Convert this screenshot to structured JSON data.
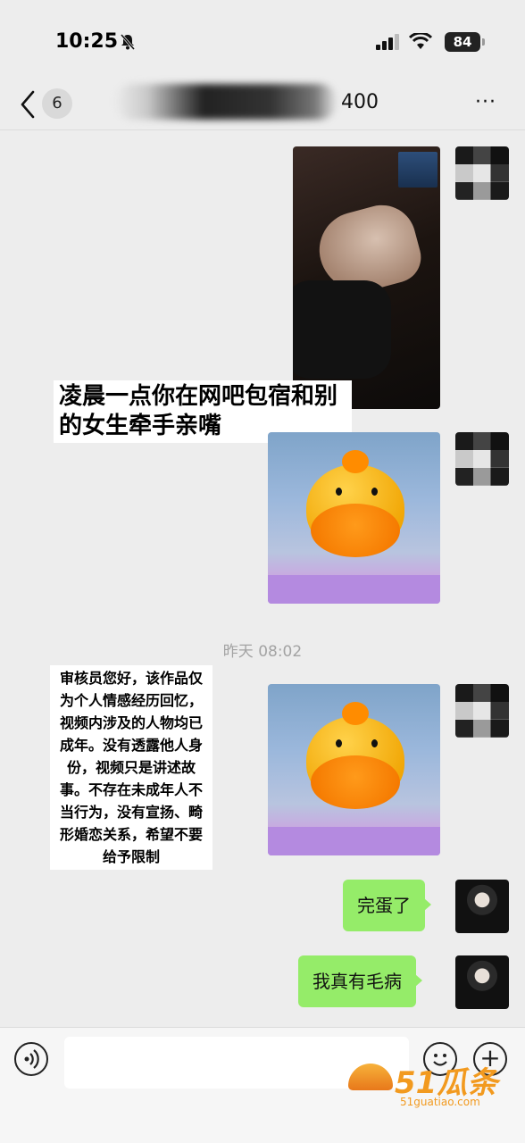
{
  "status_bar": {
    "time": "10:25",
    "battery": "84"
  },
  "nav": {
    "back_count": "6",
    "title_suffix": "400",
    "more": "···"
  },
  "messages": {
    "caption1": "凌晨一点你在网吧包宿和别的女生牵手亲嘴",
    "timestamp": "昨天 08:02",
    "caption2": "审核员您好，该作品仅为个人情感经历回忆，视频内涉及的人物均已成年。没有透露他人身份，视频只是讲述故事。不存在未成年人不当行为，没有宣扬、畸形婚恋关系，希望不要给予限制",
    "bubble1": "完蛋了",
    "bubble2": "我真有毛病"
  },
  "watermark": {
    "main": "51瓜条",
    "sub": "51guatiao.com"
  },
  "colors": {
    "bubble_green": "#95ec69",
    "background": "#ededed",
    "watermark": "#f29a1f"
  },
  "icons": [
    "bell-slash-icon",
    "signal-icon",
    "wifi-icon",
    "battery-icon",
    "back-chevron-icon",
    "more-icon",
    "voice-icon",
    "emoji-icon",
    "plus-icon"
  ]
}
